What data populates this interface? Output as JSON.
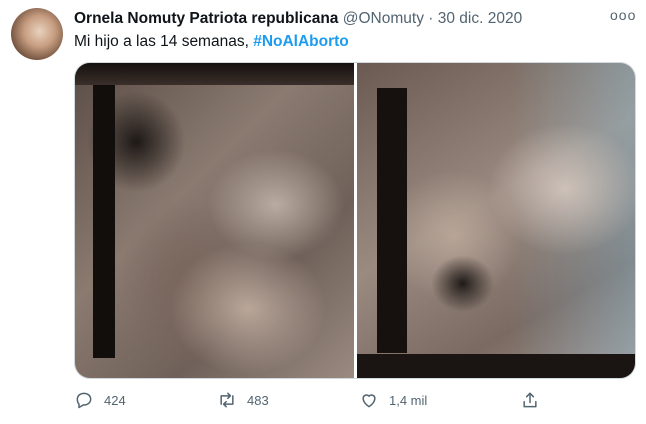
{
  "tweet": {
    "display_name": "Ornela Nomuty Patriota republicana",
    "handle": "@ONomuty",
    "separator": "·",
    "date": "30 dic. 2020",
    "more_label": "ooo",
    "text": "Mi hijo a las 14 semanas, ",
    "hashtag": "#NoAlAborto"
  },
  "actions": {
    "reply_count": "424",
    "retweet_count": "483",
    "like_count": "1,4 mil"
  },
  "icons": [
    "reply-icon",
    "retweet-icon",
    "like-icon",
    "share-icon",
    "more-icon"
  ],
  "colors": {
    "accent": "#1d9bf0",
    "secondary_text": "#536471",
    "text": "#0f1419"
  }
}
